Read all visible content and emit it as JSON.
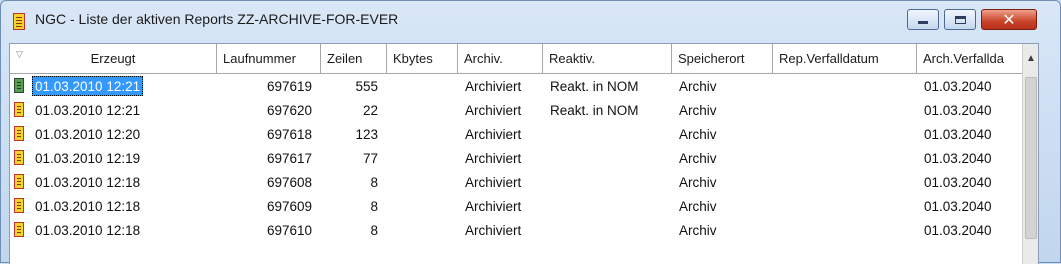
{
  "window": {
    "title": "NGC - Liste der aktiven Reports ZZ-ARCHIVE-FOR-EVER",
    "buttons": {
      "minimize": "minimize",
      "maximize": "maximize",
      "close": "✕"
    }
  },
  "columns": [
    "Erzeugt",
    "Laufnummer",
    "Zeilen",
    "Kbytes",
    "Archiv.",
    "Reaktiv.",
    "Speicherort",
    "Rep.Verfalldatum",
    "Arch.Verfallda"
  ],
  "rows": [
    {
      "icon": "report-green-icon",
      "erzeugt": "01.03.2010 12:21",
      "laufnummer": "697619",
      "zeilen": "555",
      "kbytes": "",
      "archiv": "Archiviert",
      "reaktiv": "Reakt. in NOM",
      "speicherort": "Archiv",
      "rep_verfall": "",
      "arch_verfall": "01.03.2040",
      "selected": true
    },
    {
      "icon": "report-yellow-icon",
      "erzeugt": "01.03.2010 12:21",
      "laufnummer": "697620",
      "zeilen": "22",
      "kbytes": "",
      "archiv": "Archiviert",
      "reaktiv": "Reakt. in NOM",
      "speicherort": "Archiv",
      "rep_verfall": "",
      "arch_verfall": "01.03.2040",
      "selected": false
    },
    {
      "icon": "report-yellow-icon",
      "erzeugt": "01.03.2010 12:20",
      "laufnummer": "697618",
      "zeilen": "123",
      "kbytes": "",
      "archiv": "Archiviert",
      "reaktiv": "",
      "speicherort": "Archiv",
      "rep_verfall": "",
      "arch_verfall": "01.03.2040",
      "selected": false
    },
    {
      "icon": "report-yellow-icon",
      "erzeugt": "01.03.2010 12:19",
      "laufnummer": "697617",
      "zeilen": "77",
      "kbytes": "",
      "archiv": "Archiviert",
      "reaktiv": "",
      "speicherort": "Archiv",
      "rep_verfall": "",
      "arch_verfall": "01.03.2040",
      "selected": false
    },
    {
      "icon": "report-yellow-icon",
      "erzeugt": "01.03.2010 12:18",
      "laufnummer": "697608",
      "zeilen": "8",
      "kbytes": "",
      "archiv": "Archiviert",
      "reaktiv": "",
      "speicherort": "Archiv",
      "rep_verfall": "",
      "arch_verfall": "01.03.2040",
      "selected": false
    },
    {
      "icon": "report-yellow-icon",
      "erzeugt": "01.03.2010 12:18",
      "laufnummer": "697609",
      "zeilen": "8",
      "kbytes": "",
      "archiv": "Archiviert",
      "reaktiv": "",
      "speicherort": "Archiv",
      "rep_verfall": "",
      "arch_verfall": "01.03.2040",
      "selected": false
    },
    {
      "icon": "report-yellow-icon",
      "erzeugt": "01.03.2010 12:18",
      "laufnummer": "697610",
      "zeilen": "8",
      "kbytes": "",
      "archiv": "Archiviert",
      "reaktiv": "",
      "speicherort": "Archiv",
      "rep_verfall": "",
      "arch_verfall": "01.03.2040",
      "selected": false
    }
  ],
  "colors": {
    "selection": "#3399ff",
    "close_button": "#c8432a"
  }
}
